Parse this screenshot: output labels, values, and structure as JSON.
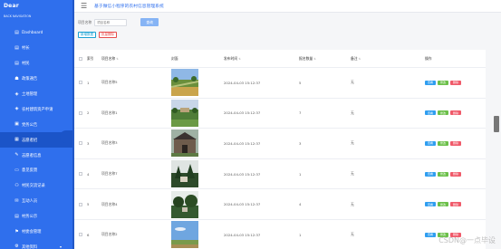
{
  "brand": {
    "logo": "Dear",
    "name": "BACK NAVIGATION"
  },
  "sidebar": {
    "items": [
      {
        "icon": "▤",
        "icon_name": "dashboard-icon",
        "label": "Dashboard",
        "active": false
      },
      {
        "icon": "▤",
        "icon_name": "grid-icon",
        "label": "村长",
        "active": false
      },
      {
        "icon": "▤",
        "icon_name": "grid-icon",
        "label": "村民",
        "active": false
      },
      {
        "icon": "☗",
        "icon_name": "house-icon",
        "label": "政策通告",
        "active": false
      },
      {
        "icon": "◈",
        "icon_name": "target-icon",
        "label": "土地管理",
        "active": false
      },
      {
        "icon": "◈",
        "icon_name": "target-icon",
        "label": "农村建筑资产申请",
        "active": false
      },
      {
        "icon": "▣",
        "icon_name": "book-icon",
        "label": "党务公告",
        "active": false
      },
      {
        "icon": "▦",
        "icon_name": "briefcase-icon",
        "label": "志愿者招",
        "active": true
      },
      {
        "icon": "✎",
        "icon_name": "edit-icon",
        "label": "志愿者信息",
        "active": false
      },
      {
        "icon": "▭",
        "icon_name": "laptop-icon",
        "label": "意见反馈",
        "active": false
      },
      {
        "icon": "⚇",
        "icon_name": "people-icon",
        "label": "村民交流记录",
        "active": false
      },
      {
        "icon": "✉",
        "icon_name": "mail-icon",
        "label": "互动人员",
        "active": false
      },
      {
        "icon": "▤",
        "icon_name": "grid-icon",
        "label": "村务公示",
        "active": false
      },
      {
        "icon": "⚑",
        "icon_name": "flag-icon",
        "label": "村委会管理",
        "active": false
      },
      {
        "icon": "⚙",
        "icon_name": "gear-icon",
        "label": "其他资料",
        "active": false,
        "has_caret": true
      }
    ]
  },
  "header": {
    "title": "基于微信小程序的农村信息管理系统"
  },
  "search": {
    "label": "项目名称",
    "placeholder": "项目名称",
    "button": "查询"
  },
  "actions": {
    "add": "新增数据",
    "delete": "批量删除"
  },
  "table": {
    "columns": [
      "索引",
      "项目名称",
      "封面",
      "发布时间",
      "报名数量",
      "备注",
      "操作"
    ],
    "ops": {
      "view": "查看",
      "edit": "修改",
      "delete": "删除"
    },
    "rows": [
      {
        "index": "1",
        "name": "项目名称5",
        "time": "2024-04-03 15:12:37",
        "count": "5",
        "note": "无",
        "img": "field"
      },
      {
        "index": "2",
        "name": "项目名称1",
        "time": "2024-04-03 15:12:37",
        "count": "7",
        "note": "无",
        "img": "village"
      },
      {
        "index": "3",
        "name": "项目名称3",
        "time": "2024-04-03 15:12:37",
        "count": "3",
        "note": "无",
        "img": "house"
      },
      {
        "index": "4",
        "name": "项目名称7",
        "time": "2024-04-03 15:12:37",
        "count": "1",
        "note": "无",
        "img": "forest"
      },
      {
        "index": "5",
        "name": "项目名称4",
        "time": "2024-04-03 15:12:37",
        "count": "4",
        "note": "无",
        "img": "trees"
      },
      {
        "index": "6",
        "name": "项目名称2",
        "time": "2024-04-03 15:12:37",
        "count": "1",
        "note": "无",
        "img": "sky"
      }
    ]
  },
  "watermark": "CSDN@一点毕设"
}
